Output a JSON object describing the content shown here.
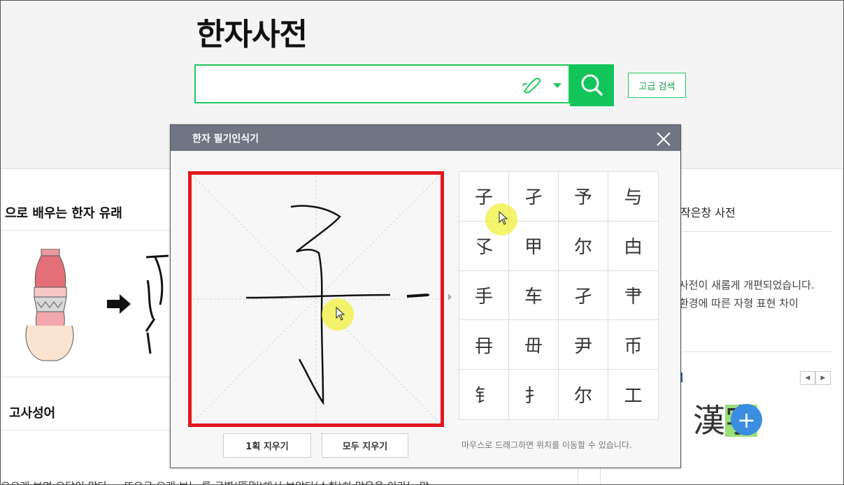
{
  "page": {
    "title": "한자사전",
    "advanced_search_label": "고급 검색",
    "search_placeholder": ""
  },
  "left": {
    "section_title": "으로 배우는 한자 유래",
    "idiom_title": "고사성어",
    "bottom_text": "으으래 보면 오답이 많다 ... 또으로 오래 보는 를 구별(區別)해서 보았다(소한)히 많은을 이라는 말"
  },
  "right": {
    "title": "작은창 사전",
    "line1": "사전이 새롭게 개편되었습니다.",
    "line2": "환경에 따른 자형 표현 차이",
    "pager_prev": "◀",
    "pager_next": "▶",
    "logo_text_1": "漢",
    "logo_text_2": "字",
    "plus_label": "+"
  },
  "modal": {
    "title": "한자 필기인식기",
    "undo_label": "1획 지우기",
    "clear_label": "모두 지우기",
    "hint": "마우스로 드래그하면 위치를 이동할 수 있습니다.",
    "candidates": [
      "子",
      "孑",
      "予",
      "与",
      "孓",
      "甲",
      "尔",
      "甴",
      "手",
      "车",
      "孑",
      "肀",
      "冄",
      "毌",
      "尹",
      "币",
      "钅",
      "扌",
      "尔",
      "工"
    ]
  },
  "colors": {
    "accent_green": "#12c55a",
    "modal_header": "#6f7583",
    "canvas_border": "#e3171e"
  },
  "icons": [
    "pen-icon",
    "chevron-down-icon",
    "search-icon",
    "close-icon",
    "cursor-icon",
    "arrow-right-icon",
    "vase-illustration"
  ]
}
